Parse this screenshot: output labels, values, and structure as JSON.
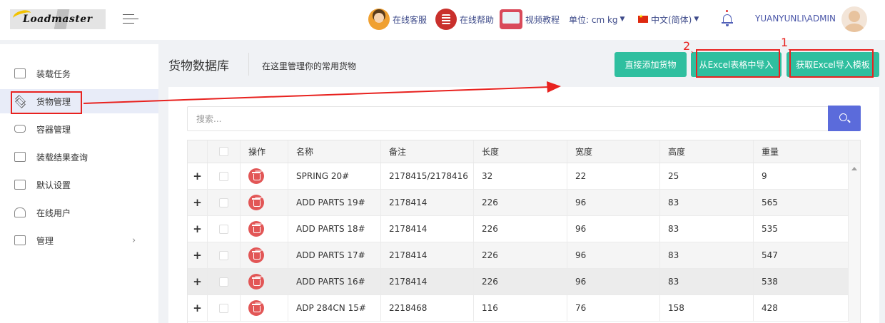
{
  "header": {
    "logo_text": "Loadmaster",
    "customer_service": "在线客服",
    "online_help": "在线帮助",
    "video_tutorial": "视频教程",
    "unit": "单位: cm kg",
    "language": "中文(简体)",
    "username": "YUANYUNLI\\ADMIN"
  },
  "sidebar": {
    "items": [
      {
        "label": "装载任务"
      },
      {
        "label": "货物管理"
      },
      {
        "label": "容器管理"
      },
      {
        "label": "装载结果查询"
      },
      {
        "label": "默认设置"
      },
      {
        "label": "在线用户"
      },
      {
        "label": "管理"
      }
    ]
  },
  "page": {
    "title": "货物数据库",
    "subtitle": "在这里管理你的常用货物",
    "btn_add": "直接添加货物",
    "btn_import": "从Excel表格中导入",
    "btn_template": "获取Excel导入模板"
  },
  "annotations": {
    "num1": "1",
    "num2": "2",
    "tick": "、"
  },
  "search": {
    "placeholder": "搜索..."
  },
  "table": {
    "headers": [
      "操作",
      "名称",
      "备注",
      "长度",
      "宽度",
      "高度",
      "重量"
    ],
    "rows": [
      {
        "plus": "+",
        "name": "SPRING 20#",
        "remark": "2178415/2178416",
        "length": "32",
        "width": "22",
        "height": "25",
        "weight": "9"
      },
      {
        "plus": "+",
        "name": "ADD PARTS 19#",
        "remark": "2178414",
        "length": "226",
        "width": "96",
        "height": "83",
        "weight": "565"
      },
      {
        "plus": "+",
        "name": "ADD PARTS 18#",
        "remark": "2178414",
        "length": "226",
        "width": "96",
        "height": "83",
        "weight": "535"
      },
      {
        "plus": "+",
        "name": "ADD PARTS 17#",
        "remark": "2178414",
        "length": "226",
        "width": "96",
        "height": "83",
        "weight": "547"
      },
      {
        "plus": "+",
        "name": "ADD PARTS 16#",
        "remark": "2178414",
        "length": "226",
        "width": "96",
        "height": "83",
        "weight": "538"
      },
      {
        "plus": "+",
        "name": "ADP 284CN 15#",
        "remark": "2218468",
        "length": "116",
        "width": "76",
        "height": "158",
        "weight": "428"
      }
    ]
  },
  "colors": {
    "accent": "#5b6bdb",
    "button": "#2fbf9f",
    "annotation": "#e8221f",
    "delete": "#e25656"
  }
}
